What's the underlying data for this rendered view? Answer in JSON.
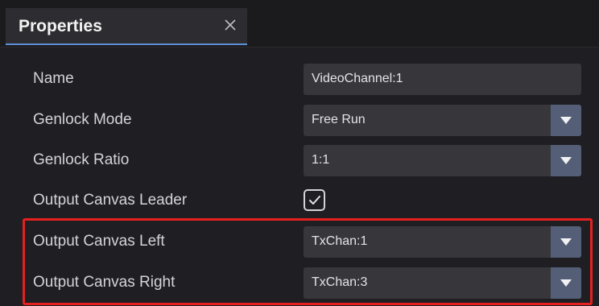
{
  "panel": {
    "tab_title": "Properties"
  },
  "properties": {
    "name": {
      "label": "Name",
      "value": "VideoChannel:1"
    },
    "genlock_mode": {
      "label": "Genlock Mode",
      "value": "Free Run"
    },
    "genlock_ratio": {
      "label": "Genlock Ratio",
      "value": "1:1"
    },
    "output_canvas_leader": {
      "label": "Output Canvas Leader",
      "checked": true
    },
    "output_canvas_left": {
      "label": "Output Canvas Left",
      "value": "TxChan:1"
    },
    "output_canvas_right": {
      "label": "Output Canvas Right",
      "value": "TxChan:3"
    }
  },
  "icons": {
    "close": "close-icon",
    "dropdown": "triangle-down-icon",
    "check": "checkmark-icon"
  },
  "colors": {
    "background": "#1f1f23",
    "field": "#36363b",
    "dropdown_button": "#545f77",
    "tab_accent": "#5c8fd6",
    "highlight": "#e5201f"
  }
}
